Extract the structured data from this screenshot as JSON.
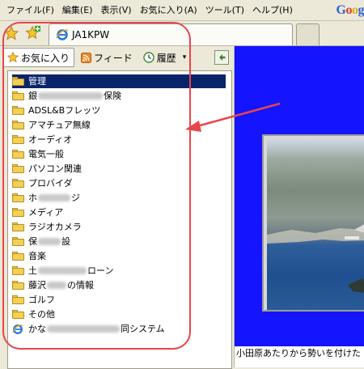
{
  "menubar": {
    "items": [
      "ファイル(F)",
      "編集(E)",
      "表示(V)",
      "お気に入り(A)",
      "ツール(T)",
      "ヘルプ(H)"
    ],
    "brand_letters": [
      "G",
      "o",
      "o",
      "g"
    ]
  },
  "toolbar": {
    "favorites_center_icon": "star-icon",
    "add_favorite_icon": "add-favorite-star-icon"
  },
  "tab": {
    "title": "JA1KPW",
    "icon": "ie-icon"
  },
  "panel": {
    "tabs": [
      {
        "label": "お気に入り",
        "icon": "star-icon",
        "active": true
      },
      {
        "label": "フィード",
        "icon": "rss-feed-icon",
        "active": false
      },
      {
        "label": "履歴",
        "icon": "history-icon",
        "active": false,
        "dropdown": "▾"
      }
    ],
    "items": [
      {
        "prefix": "管理",
        "suffix": "",
        "blur": 0,
        "type": "folder",
        "selected": true
      },
      {
        "prefix": "銀",
        "suffix": "保険",
        "blur": 80,
        "type": "folder"
      },
      {
        "prefix": "ADSL&Bフレッツ",
        "suffix": "",
        "blur": 0,
        "type": "folder"
      },
      {
        "prefix": "アマチュア無線",
        "suffix": "",
        "blur": 0,
        "type": "folder"
      },
      {
        "prefix": "オーディオ",
        "suffix": "",
        "blur": 0,
        "type": "folder"
      },
      {
        "prefix": "電気一般",
        "suffix": "",
        "blur": 0,
        "type": "folder"
      },
      {
        "prefix": "パソコン関連",
        "suffix": "",
        "blur": 0,
        "type": "folder"
      },
      {
        "prefix": "プロバイダ",
        "suffix": "",
        "blur": 0,
        "type": "folder"
      },
      {
        "prefix": "ホ",
        "suffix": "ジ",
        "blur": 40,
        "type": "folder"
      },
      {
        "prefix": "メディア",
        "suffix": "",
        "blur": 0,
        "type": "folder"
      },
      {
        "prefix": "ラジオカメラ",
        "suffix": "",
        "blur": 0,
        "type": "folder"
      },
      {
        "prefix": "保",
        "suffix": "設",
        "blur": 28,
        "type": "folder"
      },
      {
        "prefix": "音楽",
        "suffix": "",
        "blur": 0,
        "type": "folder"
      },
      {
        "prefix": "土",
        "suffix": "ローン",
        "blur": 60,
        "type": "folder"
      },
      {
        "prefix": "藤沢",
        "suffix": "の情報",
        "blur": 24,
        "type": "folder"
      },
      {
        "prefix": "ゴルフ",
        "suffix": "",
        "blur": 0,
        "type": "folder"
      },
      {
        "prefix": "その他",
        "suffix": "",
        "blur": 0,
        "type": "folder"
      },
      {
        "prefix": "かな",
        "suffix": "同システム",
        "blur": 90,
        "type": "link"
      }
    ]
  },
  "content": {
    "caption": "小田原あたりから勢いを付けた"
  },
  "annotation": {
    "color": "#e8454c"
  }
}
